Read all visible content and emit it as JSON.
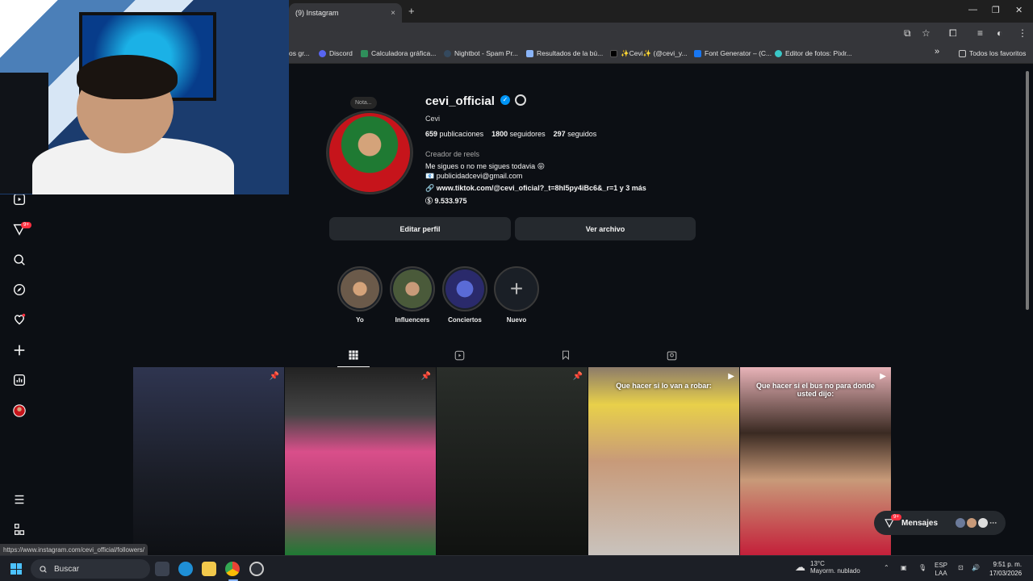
{
  "browser": {
    "tab_title": "(9) Instagram",
    "tab_close": "×",
    "new_tab": "+",
    "window_controls": [
      "—",
      "❐",
      "✕"
    ],
    "bookmarks": [
      {
        "label": "os gr...",
        "color": "#5f6368"
      },
      {
        "label": "Discord",
        "color": "#5865f2"
      },
      {
        "label": "Calculadora gráfica...",
        "color": "#2f8f5b"
      },
      {
        "label": "Nightbot - Spam Pr...",
        "color": "#34495e"
      },
      {
        "label": "Resultados de la bú...",
        "color": "#8ab4f8"
      },
      {
        "label": "✨Cevi✨ (@cevi_y...",
        "color": "#000000"
      },
      {
        "label": "Font Generator – (C...",
        "color": "#1877f2"
      },
      {
        "label": "Editor de fotos: Pixlr...",
        "color": "#3ac7c7"
      }
    ],
    "bookmarks_more": "»",
    "all_bookmarks": "Todos los favoritos",
    "status_url": "https://www.instagram.com/cevi_official/followers/"
  },
  "sidebar": {
    "notification_badge": "9+",
    "items": [
      "reels-icon",
      "messages-icon",
      "search-icon",
      "explore-icon",
      "notifications-icon",
      "create-icon",
      "dashboard-icon",
      "profile-icon",
      "menu-icon",
      "threads-icon"
    ]
  },
  "profile": {
    "note": "Nota...",
    "username": "cevi_official",
    "full_name": "Cevi",
    "posts_count": "659",
    "posts_label": "publicaciones",
    "followers_count": "1800",
    "followers_label": "seguidores",
    "following_count": "297",
    "following_label": "seguidos",
    "category": "Creador de reels",
    "bio_line1": "Me sigues o no me sigues todavia 😝",
    "bio_line2": "📧 publicidadcevi@gmail.com",
    "link": "🔗 www.tiktok.com/@cevi_oficial?_t=8hl5py4iBc6&_r=1 y 3 más",
    "threads": "Ⓢ 9.533.975",
    "edit_button": "Editar perfil",
    "archive_button": "Ver archivo"
  },
  "highlights": [
    {
      "label": "Yo",
      "color": "#6b5a4a"
    },
    {
      "label": "Influencers",
      "color": "#4a5a3a"
    },
    {
      "label": "Conciertos",
      "color": "#2a2a6b"
    },
    {
      "label": "Nuevo",
      "color": ""
    }
  ],
  "posts": [
    {
      "caption": "",
      "pinned": true,
      "icon": "pin-icon",
      "colors": [
        "#3a3f5a",
        "#1a1d26"
      ]
    },
    {
      "caption": "",
      "pinned": true,
      "icon": "pin-icon",
      "colors": [
        "#d94f8a",
        "#1f7a33"
      ]
    },
    {
      "caption": "",
      "pinned": true,
      "icon": "pin-icon",
      "colors": [
        "#2a2e2a",
        "#101210"
      ]
    },
    {
      "caption": "Que hacer si lo van a robar:",
      "pinned": false,
      "icon": "reel-icon",
      "colors": [
        "#e8d04a",
        "#c9c3bd"
      ]
    },
    {
      "caption": "Que hacer si el bus no para donde usted dijo:",
      "pinned": false,
      "icon": "reel-icon",
      "colors": [
        "#e8b3b8",
        "#c4203a"
      ]
    }
  ],
  "messages": {
    "label": "Mensajes",
    "badge": "9+"
  },
  "taskbar": {
    "search_placeholder": "Buscar",
    "weather_temp": "13°C",
    "weather_desc": "Mayorm. nublado",
    "lang": "ESP",
    "lang_sub": "LAA",
    "time": "9:51 p. m.",
    "date": "17/03/2026"
  }
}
